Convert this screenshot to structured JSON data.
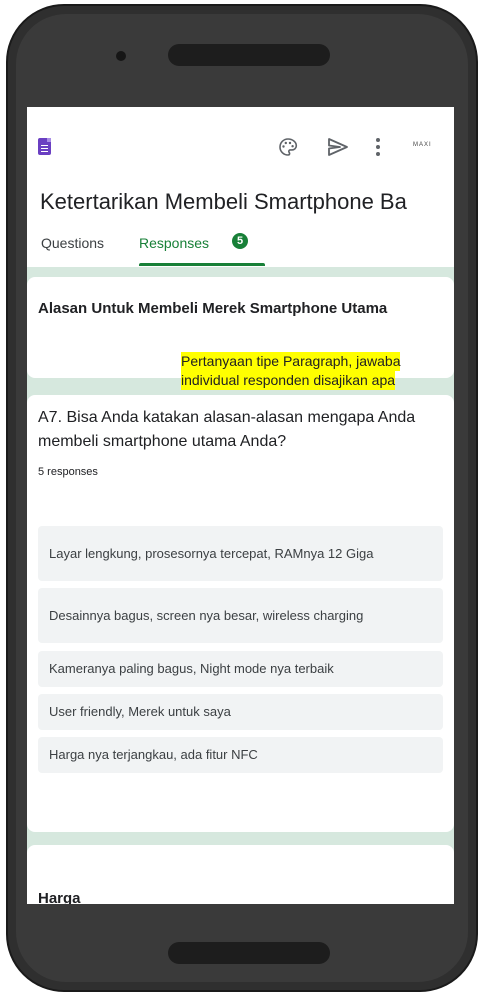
{
  "app": {
    "form_title": "Ketertarikan Membeli Smartphone Ba",
    "brand_logo_text": "MAXI",
    "tabs": [
      {
        "label": "Questions"
      },
      {
        "label": "Responses",
        "badge": "5"
      }
    ]
  },
  "icons": [
    "forms-icon",
    "palette-icon",
    "send-icon",
    "more-vert-icon"
  ],
  "section": {
    "title": "Alasan Untuk Membeli Merek Smartphone Utama"
  },
  "question": {
    "title": "A7. Bisa Anda katakan alasan-alasan mengapa Anda membeli smartphone utama Anda?",
    "response_count": "5 responses",
    "answers": [
      "Layar lengkung, prosesornya tercepat, RAMnya 12 Giga",
      "Desainnya bagus, screen nya besar, wireless charging",
      "Kameranya paling bagus, Night mode nya terbaik",
      "User friendly, Merek untuk saya",
      "Harga nya terjangkau, ada fitur NFC"
    ]
  },
  "next_section": {
    "title": "Harga"
  },
  "annotation": {
    "line1": "Pertanyaan tipe Paragraph, jawaba",
    "line2": "individual responden disajikan apa"
  },
  "colors": {
    "accent": "#188038",
    "background_tint": "#d6e8de",
    "forms_purple": "#6a3fc2",
    "highlight": "#ffff00"
  }
}
